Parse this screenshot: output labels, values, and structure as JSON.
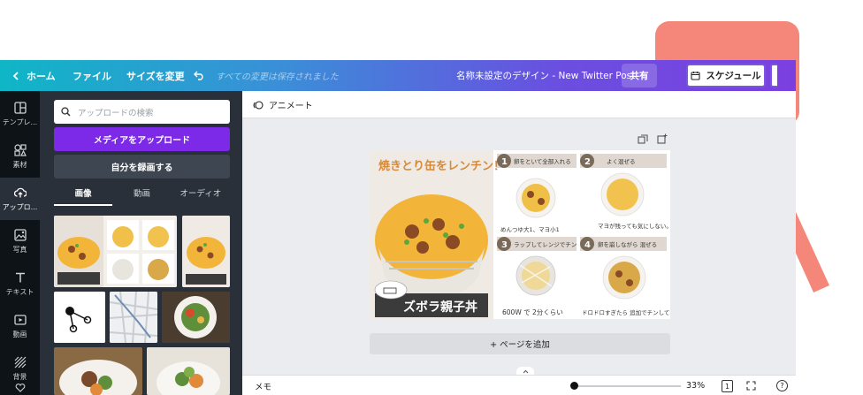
{
  "topbar": {
    "home": "ホーム",
    "file": "ファイル",
    "resize": "サイズを変更",
    "saved_status": "すべての変更は保存されました",
    "doc_title": "名称未設定のデザイン - New Twitter Post",
    "share": "共有",
    "schedule": "スケジュール"
  },
  "rail": {
    "items": [
      {
        "label": "テンプレ..."
      },
      {
        "label": "素材"
      },
      {
        "label": "アップロ..."
      },
      {
        "label": "写真"
      },
      {
        "label": "テキスト"
      },
      {
        "label": "動画"
      },
      {
        "label": "背景"
      }
    ]
  },
  "panel": {
    "search_placeholder": "アップロードの検索",
    "upload_button": "メディアをアップロード",
    "record_button": "自分を録画する",
    "tabs": [
      {
        "label": "画像"
      },
      {
        "label": "動画"
      },
      {
        "label": "オーディオ"
      }
    ]
  },
  "editor": {
    "animate": "アニメート",
    "add_page": "+ ページを追加"
  },
  "design": {
    "headline": "焼きとり缶をレンチン！",
    "dish_name": "ズボラ親子丼",
    "steps": [
      {
        "num": "1",
        "title": "卵をといて全部入れる",
        "note": "めんつゆ大1、マヨ小1"
      },
      {
        "num": "2",
        "title": "よく混ぜる",
        "note": "マヨが残っても気にしない。"
      },
      {
        "num": "3",
        "title": "ラップしてレンジでチン",
        "note": "600W で 2分くらい"
      },
      {
        "num": "4",
        "title": "卵を崩しながら 混ぜる",
        "note": "ドロドロすぎたら 追加でチンしてね"
      }
    ]
  },
  "bottombar": {
    "memo": "メモ",
    "zoom": "33%",
    "page_count": "1",
    "help": "?"
  },
  "colors": {
    "accent_purple": "#7d2ae8",
    "highlight": "#f5877a"
  }
}
